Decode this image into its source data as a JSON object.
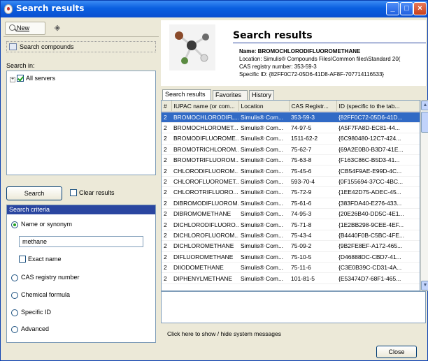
{
  "window": {
    "title": "Search results",
    "minimize": "_",
    "maximize": "□",
    "close": "×"
  },
  "toolbar": {
    "new_label": "New",
    "erase_icon": "eraser-icon"
  },
  "left": {
    "search_compounds": "Search compounds",
    "search_in_label": "Search in:",
    "tree": {
      "expander": "+",
      "item": "All servers",
      "checked": true
    },
    "search_button": "Search",
    "clear_results": "Clear results",
    "criteria_header": "Search criteria",
    "criteria": {
      "name_label": "Name or synonym",
      "name_value": "methane",
      "exact_name": "Exact name",
      "cas": "CAS registry number",
      "formula": "Chemical formula",
      "specific_id": "Specific ID",
      "advanced": "Advanced",
      "selected": "name"
    }
  },
  "info": {
    "title": "Search results",
    "name": "Name: BROMOCHLORODIFLUOROMETHANE",
    "location": "Location: Simulis® Compounds Files\\Common files\\Standard 20(",
    "cas": "CAS registry number: 353-59-3",
    "specific_id": "Specific ID: {82FF0C72-05D6-41D8-AF8F-707714116533}"
  },
  "tabs": [
    "Search results",
    "Favorites",
    "History"
  ],
  "table": {
    "headers": [
      "#",
      "IUPAC name (or com...",
      "Location",
      "CAS Registr...",
      "ID (specific to the tab..."
    ],
    "rows": [
      [
        "2",
        "BROMOCHLORODIFL...",
        "Simulis® Com...",
        "353-59-3",
        "{82FF0C72-05D6-41D..."
      ],
      [
        "2",
        "BROMOCHLOROMET...",
        "Simulis® Com...",
        "74-97-5",
        "{A5F7FA8D-EC81-44..."
      ],
      [
        "2",
        "BROMODIFLUOROME...",
        "Simulis® Com...",
        "1511-62-2",
        "{6C980480-12C7-424..."
      ],
      [
        "2",
        "BROMOTRICHLOROM...",
        "Simulis® Com...",
        "75-62-7",
        "{69A2E0B0-B3D7-41E..."
      ],
      [
        "2",
        "BROMOTRIFLUOROM...",
        "Simulis® Com...",
        "75-63-8",
        "{F163C86C-B5D3-41..."
      ],
      [
        "2",
        "CHLORODIFLUOROM...",
        "Simulis® Com...",
        "75-45-6",
        "{CB54F9AE-E99D-4C..."
      ],
      [
        "2",
        "CHLOROFLUOROMET...",
        "Simulis® Com...",
        "593-70-4",
        "{0F155694-37CC-4BC..."
      ],
      [
        "2",
        "CHLOROTRIFLUORO...",
        "Simulis® Com...",
        "75-72-9",
        "{1EE42D75-ADEC-45..."
      ],
      [
        "2",
        "DIBROMODIFLUOROM...",
        "Simulis® Com...",
        "75-61-6",
        "{383FDA40-E276-433..."
      ],
      [
        "2",
        "DIBROMOMETHANE",
        "Simulis® Com...",
        "74-95-3",
        "{20E26B40-DD5C-4E1..."
      ],
      [
        "2",
        "DICHLORODIFLUORO...",
        "Simulis® Com...",
        "75-71-8",
        "{1E2BB298-9CEE-4EF..."
      ],
      [
        "2",
        "DICHLOROFLUOROM...",
        "Simulis® Com...",
        "75-43-4",
        "{B4440F0B-C5BC-4FE..."
      ],
      [
        "2",
        "DICHLOROMETHANE",
        "Simulis® Com...",
        "75-09-2",
        "{9B2FE8EF-A172-465..."
      ],
      [
        "2",
        "DIFLUOROMETHANE",
        "Simulis® Com...",
        "75-10-5",
        "{D46888DC-CBD7-41..."
      ],
      [
        "2",
        "DIIODOMETHANE",
        "Simulis® Com...",
        "75-11-6",
        "{C3E0B39C-CD31-4A..."
      ],
      [
        "2",
        "DIPHENYLMETHANE",
        "Simulis® Com...",
        "101-81-5",
        "{E53474D7-68F1-465..."
      ]
    ],
    "selected_row": 0
  },
  "scroll": {
    "up": "▲",
    "down": "▼"
  },
  "messages_toggle": "Click here to show / hide system messages",
  "close_button": "Close"
}
